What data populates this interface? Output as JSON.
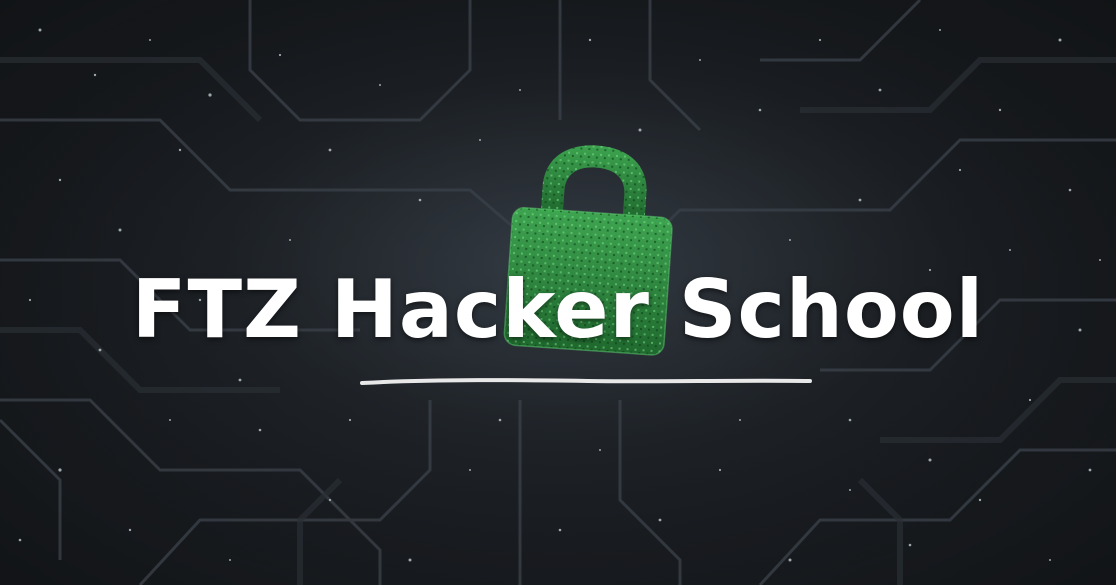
{
  "banner": {
    "title": "FTZ Hacker School",
    "icon": "padlock-icon",
    "colors": {
      "background": "#15181c",
      "lock_green": "#2f9e45",
      "title": "#ffffff",
      "underline": "#e8e8e8"
    }
  }
}
